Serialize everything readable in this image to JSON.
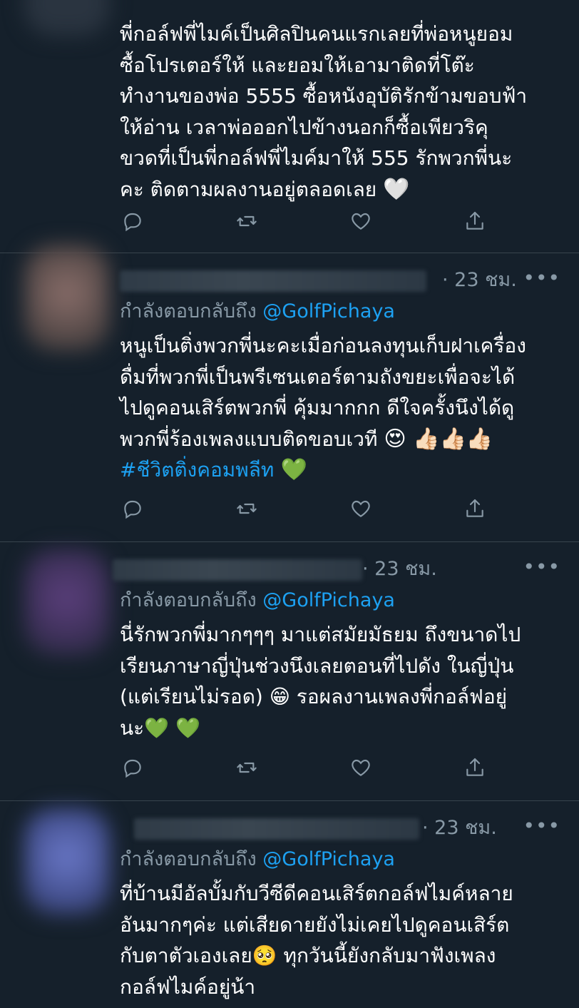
{
  "tweets": [
    {
      "text": "พี่กอล์ฟพี่ไมค์เป็นศิลปินคนแรกเลยที่พ่อหนูยอม\nซื้อโปรเตอร์ให้ และยอมให้เอามาติดที่โต๊ะ\nทำงานของพ่อ 5555 ซื้อหนังอุบัติรักข้ามขอบฟ้า\nให้อ่าน เวลาพ่อออกไปข้างนอกก็ซื้อเพียวริคุ\nขวดที่เป็นพี่กอล์ฟพี่ไมค์มาให้ 555 รักพวกพี่นะ\nคะ ติดตามผลงานอยู่ตลอดเลย ",
      "emoji": "🤍"
    },
    {
      "time": "· 23 ชม.",
      "reply_label": "กำลังตอบกลับถึง",
      "reply_handle": "@GolfPichaya",
      "text": "หนูเป็นติ่งพวกพี่นะคะเมื่อก่อนลงทุนเก็บฝาเครื่อง\nดื่มที่พวกพี่เป็นพรีเซนเตอร์ตามถังขยะเพื่อจะได้\nไปดูคอนเสิร์ตพวกพี่ คุ้มมากกก ดีใจครั้งนึงได้ดู\nพวกพี่ร้องเพลงแบบติดขอบเวที ",
      "emoji": "😍 👍🏻👍🏻👍🏻",
      "hashtag": "#ชีวิตติ่งคอมพลีท",
      "hashtag_emoji": " 💚"
    },
    {
      "time": "· 23 ชม.",
      "reply_label": "กำลังตอบกลับถึง",
      "reply_handle": "@GolfPichaya",
      "text": "นี่รักพวกพี่มากๆๆๆ มาแต่สมัยมัธยม ถึงขนาดไป\nเรียนภาษาญี่ปุ่นช่วงนึงเลยตอนที่ไปดัง ในญี่ปุ่น\n(แต่เรียนไม่รอด) 😁  รอผลงานเพลงพี่กอล์ฟอยู่\nนะ💚 💚"
    },
    {
      "time": "· 23 ชม.",
      "reply_label": "กำลังตอบกลับถึง",
      "reply_handle": "@GolfPichaya",
      "text": "ที่บ้านมีอัลบั้มกับวีซีดีคอนเสิร์ตกอล์ฟไมค์หลาย\nอันมากๆค่ะ แต่เสียดายยังไม่เคยไปดูคอนเสิร์ต\nกับตาตัวเองเลย🥺  ทุกวันนี้ยังกลับมาฟังเพลง\nกอล์ฟไมค์อยู่น้า"
    }
  ],
  "more_label": "•••",
  "icons": [
    "reply-icon",
    "retweet-icon",
    "like-icon",
    "share-icon"
  ],
  "colors": {
    "background": "#15202b",
    "secondary_text": "#8899a6",
    "link": "#1da1f2",
    "divider": "#38444d"
  }
}
